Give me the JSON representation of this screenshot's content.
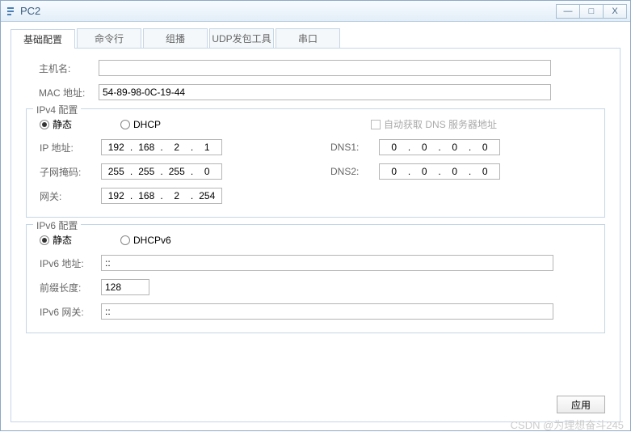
{
  "window": {
    "title": "PC2"
  },
  "tabs": [
    "基础配置",
    "命令行",
    "组播",
    "UDP发包工具",
    "串口"
  ],
  "fields": {
    "hostname_label": "主机名:",
    "hostname_value": "",
    "mac_label": "MAC 地址:",
    "mac_value": "54-89-98-0C-19-44"
  },
  "ipv4": {
    "legend": "IPv4 配置",
    "radio_static": "静态",
    "radio_dhcp": "DHCP",
    "auto_dns": "自动获取 DNS 服务器地址",
    "ip_label": "IP 地址:",
    "ip": [
      "192",
      "168",
      "2",
      "1"
    ],
    "mask_label": "子网掩码:",
    "mask": [
      "255",
      "255",
      "255",
      "0"
    ],
    "gw_label": "网关:",
    "gw": [
      "192",
      "168",
      "2",
      "254"
    ],
    "dns1_label": "DNS1:",
    "dns1": [
      "0",
      "0",
      "0",
      "0"
    ],
    "dns2_label": "DNS2:",
    "dns2": [
      "0",
      "0",
      "0",
      "0"
    ]
  },
  "ipv6": {
    "legend": "IPv6 配置",
    "radio_static": "静态",
    "radio_dhcp": "DHCPv6",
    "addr_label": "IPv6 地址:",
    "addr_value": "::",
    "prefix_label": "前缀长度:",
    "prefix_value": "128",
    "gw_label": "IPv6 网关:",
    "gw_value": "::"
  },
  "buttons": {
    "apply": "应用"
  },
  "watermark": "CSDN @为理想奋斗245"
}
